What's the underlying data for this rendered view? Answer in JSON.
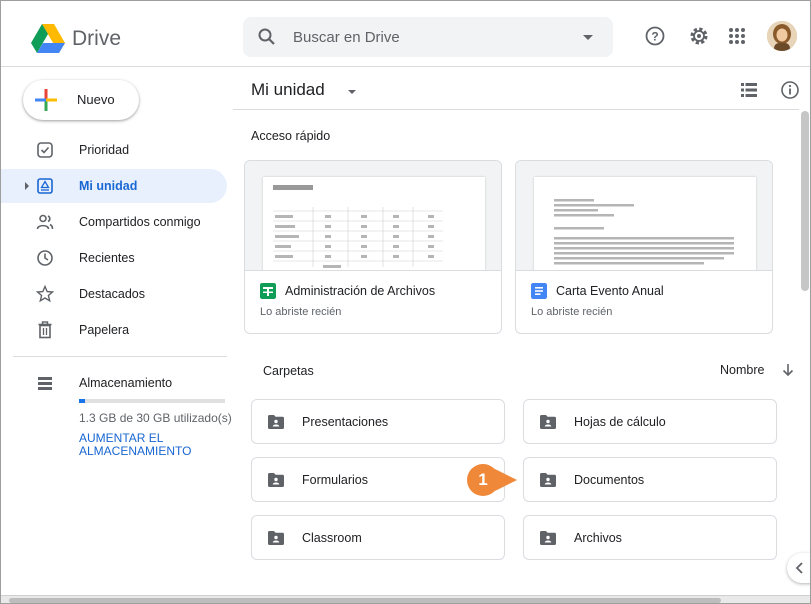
{
  "header": {
    "app_name": "Drive",
    "search_placeholder": "Buscar en Drive",
    "icons": [
      "drive-logo-icon",
      "search-icon",
      "search-options-icon",
      "help-icon",
      "settings-icon",
      "apps-grid-icon",
      "account-avatar"
    ]
  },
  "sidebar": {
    "new_label": "Nuevo",
    "items": [
      {
        "label": "Prioridad",
        "icon": "priority-icon",
        "active": false
      },
      {
        "label": "Mi unidad",
        "icon": "my-drive-icon",
        "active": true
      },
      {
        "label": "Compartidos conmigo",
        "icon": "shared-icon",
        "active": false
      },
      {
        "label": "Recientes",
        "icon": "clock-icon",
        "active": false
      },
      {
        "label": "Destacados",
        "icon": "star-icon",
        "active": false
      },
      {
        "label": "Papelera",
        "icon": "trash-icon",
        "active": false
      }
    ],
    "storage": {
      "label": "Almacenamiento",
      "usage_text": "1.3 GB de 30 GB utilizado(s)",
      "usage_fraction": 0.043,
      "upgrade_label": "AUMENTAR EL ALMACENAMIENTO"
    }
  },
  "main": {
    "title": "Mi unidad",
    "quick_access_label": "Acceso rápido",
    "quick_access": [
      {
        "name": "Administración de Archivos",
        "subtitle": "Lo abriste recién",
        "type": "sheet",
        "color": "#0f9d58"
      },
      {
        "name": "Carta Evento Anual",
        "subtitle": "Lo abriste recién",
        "type": "doc",
        "color": "#4285f4"
      }
    ],
    "folders_label": "Carpetas",
    "sort_label": "Nombre",
    "folders": [
      {
        "name": "Presentaciones"
      },
      {
        "name": "Hojas de cálculo"
      },
      {
        "name": "Formularios"
      },
      {
        "name": "Documentos"
      },
      {
        "name": "Classroom"
      },
      {
        "name": "Archivos"
      }
    ],
    "step_marker": "1"
  },
  "colors": {
    "accent": "#1a73e8",
    "active_bg": "#e8f0fe",
    "active_text": "#1967d2",
    "step_badge": "#f0883a"
  }
}
